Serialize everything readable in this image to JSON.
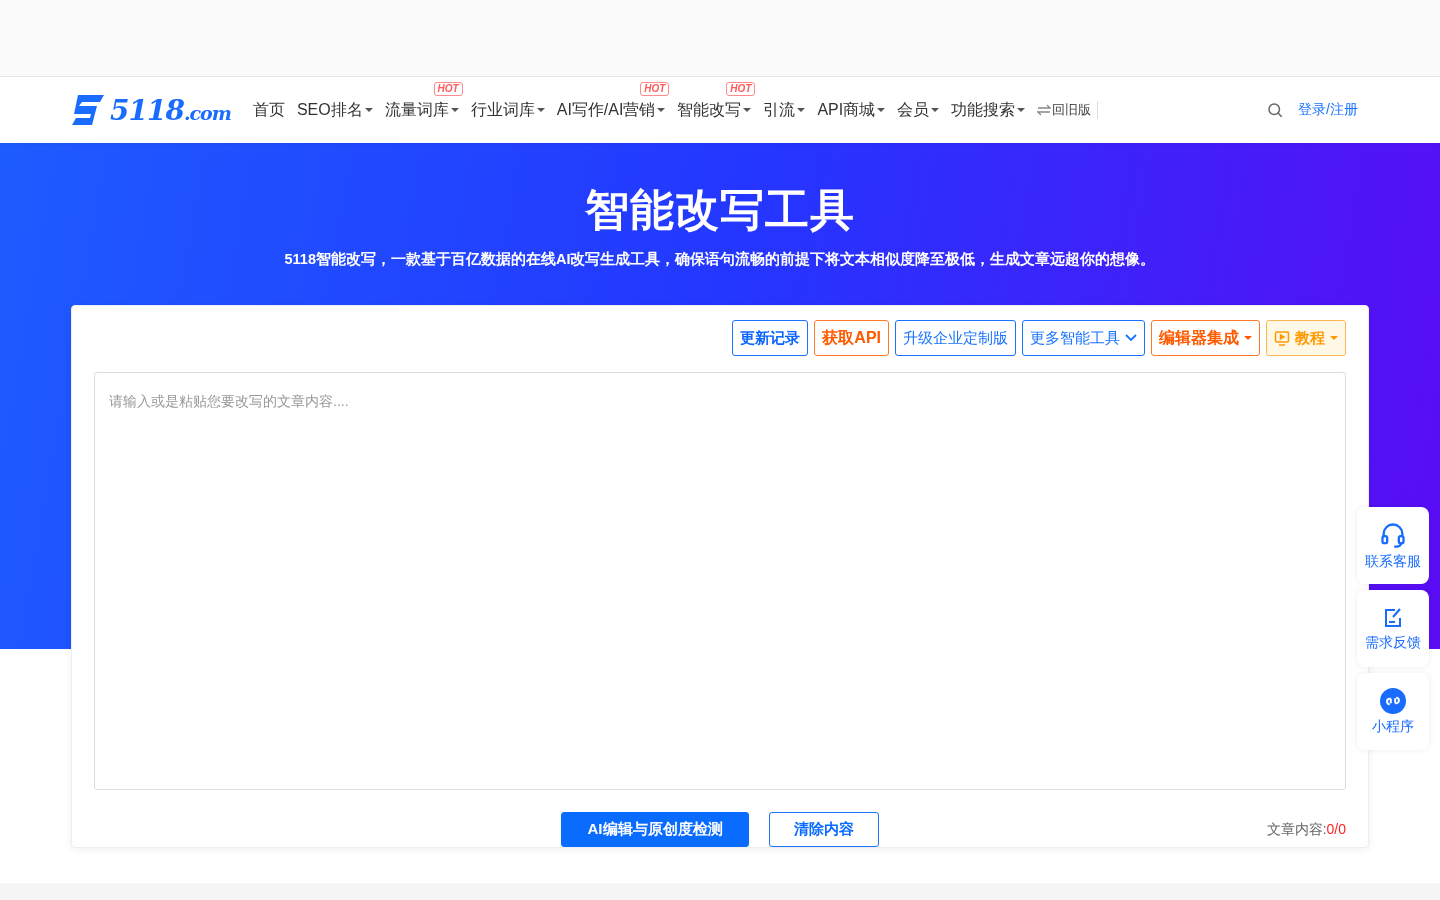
{
  "logo": {
    "text": "5118",
    "suffix": ".com"
  },
  "nav": [
    {
      "label": "首页",
      "dropdown": false
    },
    {
      "label": "SEO排名",
      "dropdown": true
    },
    {
      "label": "流量词库",
      "dropdown": true,
      "badge": "HOT"
    },
    {
      "label": "行业词库",
      "dropdown": true
    },
    {
      "label": "AI写作/AI营销",
      "dropdown": true,
      "badge": "HOT"
    },
    {
      "label": "智能改写",
      "dropdown": true,
      "badge": "HOT"
    },
    {
      "label": "引流",
      "dropdown": true
    },
    {
      "label": "API商城",
      "dropdown": true
    },
    {
      "label": "会员",
      "dropdown": true
    },
    {
      "label": "功能搜索",
      "dropdown": true
    }
  ],
  "old_version": "回旧版",
  "login": "登录/注册",
  "hero": {
    "title": "智能改写工具",
    "subtitle": "5118智能改写，一款基于百亿数据的在线AI改写生成工具，确保语句流畅的前提下将文本相似度降至极低，生成文章远超你的想像。"
  },
  "toolbar": [
    {
      "label": "更新记录",
      "kind": "blue-bold",
      "dropdown": false
    },
    {
      "label": "获取API",
      "kind": "orange",
      "dropdown": false
    },
    {
      "label": "升级企业定制版",
      "kind": "blue",
      "dropdown": false
    },
    {
      "label": "更多智能工具",
      "kind": "blue",
      "dropdown": true
    },
    {
      "label": "编辑器集成",
      "kind": "orange",
      "dropdown": true
    },
    {
      "label": "教程",
      "kind": "tutorial",
      "dropdown": true
    }
  ],
  "editor": {
    "placeholder": "请输入或是粘贴您要改写的文章内容...."
  },
  "actions": [
    {
      "label": "AI编辑与原创度检测",
      "kind": "primary"
    },
    {
      "label": "清除内容",
      "kind": "outline"
    }
  ],
  "counter": {
    "label": "文章内容:",
    "value": "0/0"
  },
  "side": [
    {
      "label": "联系客服"
    },
    {
      "label": "需求反馈"
    },
    {
      "label": "小程序"
    }
  ]
}
